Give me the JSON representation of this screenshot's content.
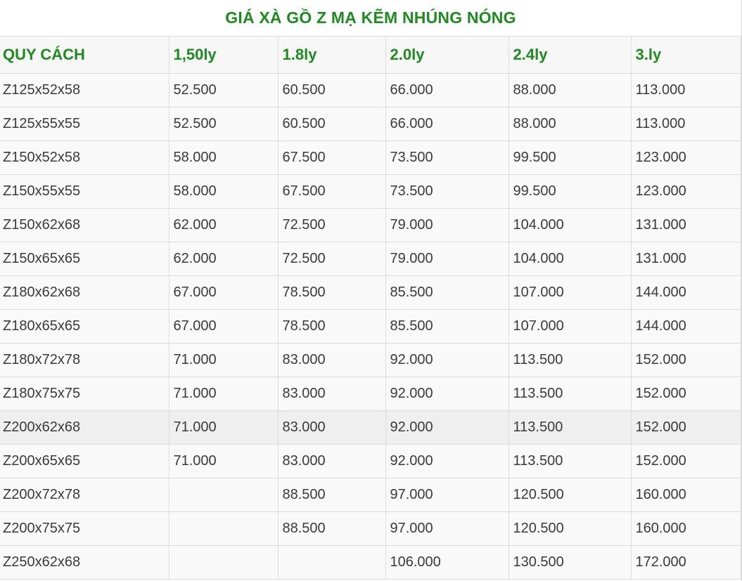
{
  "title": "GIÁ XÀ GỒ Z MẠ KẼM NHÚNG NÓNG",
  "headers": [
    "QUY CÁCH",
    "1,50ly",
    "1.8ly",
    "2.0ly",
    "2.4ly",
    "3.ly"
  ],
  "rows": [
    [
      "Z125x52x58",
      "52.500",
      "60.500",
      "66.000",
      "88.000",
      "113.000"
    ],
    [
      "Z125x55x55",
      "52.500",
      "60.500",
      "66.000",
      "88.000",
      "113.000"
    ],
    [
      "Z150x52x58",
      "58.000",
      "67.500",
      "73.500",
      "99.500",
      "123.000"
    ],
    [
      "Z150x55x55",
      "58.000",
      "67.500",
      "73.500",
      "99.500",
      "123.000"
    ],
    [
      "Z150x62x68",
      "62.000",
      "72.500",
      "79.000",
      "104.000",
      "131.000"
    ],
    [
      "Z150x65x65",
      "62.000",
      "72.500",
      "79.000",
      "104.000",
      "131.000"
    ],
    [
      "Z180x62x68",
      "67.000",
      "78.500",
      "85.500",
      "107.000",
      "144.000"
    ],
    [
      "Z180x65x65",
      "67.000",
      "78.500",
      "85.500",
      "107.000",
      "144.000"
    ],
    [
      "Z180x72x78",
      "71.000",
      "83.000",
      "92.000",
      "113.500",
      "152.000"
    ],
    [
      "Z180x75x75",
      "71.000",
      "83.000",
      "92.000",
      "113.500",
      "152.000"
    ],
    [
      "Z200x62x68",
      "71.000",
      "83.000",
      "92.000",
      "113.500",
      "152.000"
    ],
    [
      "Z200x65x65",
      "71.000",
      "83.000",
      "92.000",
      "113.500",
      "152.000"
    ],
    [
      "Z200x72x78",
      "",
      "88.500",
      "97.000",
      "120.500",
      "160.000"
    ],
    [
      "Z200x75x75",
      "",
      "88.500",
      "97.000",
      "120.500",
      "160.000"
    ],
    [
      "Z250x62x68",
      "",
      "",
      "106.000",
      "130.500",
      "172.000"
    ]
  ],
  "colors": {
    "accent": "#1f8a1f",
    "text": "#3a3a3a",
    "border": "#dcdcdc"
  }
}
